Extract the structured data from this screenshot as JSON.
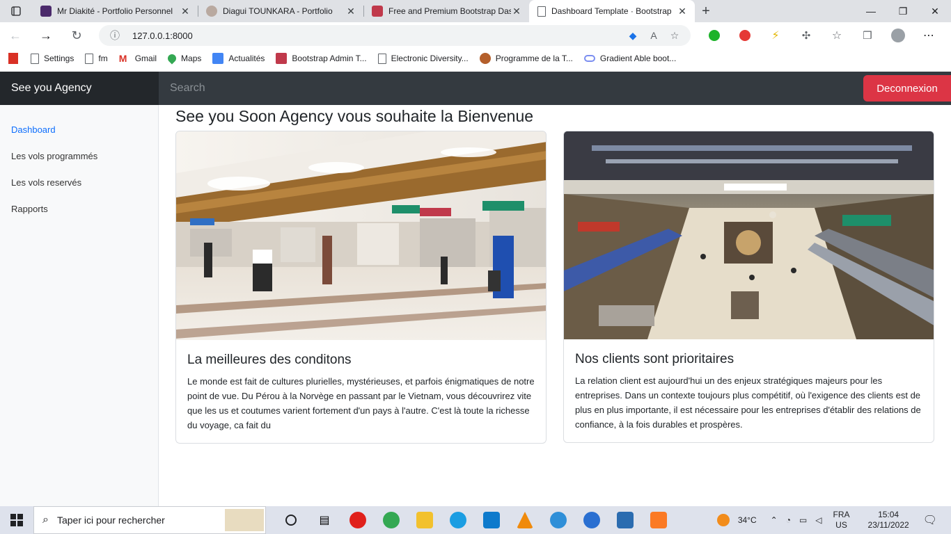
{
  "browser": {
    "tabs": [
      {
        "title": "Mr Diakité - Portfolio Personnel",
        "favicon_color": "#4b2a6b"
      },
      {
        "title": "Diagui TOUNKARA - Portfolio",
        "favicon_color": "#b9a9a0"
      },
      {
        "title": "Free and Premium Bootstrap Das",
        "favicon_color": "#c0394b"
      },
      {
        "title": "Dashboard Template · Bootstrap",
        "favicon_color": "#ffffff"
      }
    ],
    "url": "127.0.0.1:8000",
    "bookmarks": [
      {
        "label": "Settings",
        "icon": "page-icon"
      },
      {
        "label": "fm",
        "icon": "page-icon"
      },
      {
        "label": "Gmail",
        "icon": "gmail-icon"
      },
      {
        "label": "Maps",
        "icon": "maps-icon"
      },
      {
        "label": "Actualités",
        "icon": "news-icon"
      },
      {
        "label": "Bootstrap Admin T...",
        "icon": "bootstrap-icon"
      },
      {
        "label": "Electronic Diversity...",
        "icon": "page-icon"
      },
      {
        "label": "Programme de la T...",
        "icon": "globe-icon"
      },
      {
        "label": "Gradient Able boot...",
        "icon": "link-icon"
      }
    ]
  },
  "app": {
    "brand": "See you Agency",
    "search_placeholder": "Search",
    "logout_label": "Deconnexion",
    "sidebar": [
      {
        "label": "Dashboard",
        "active": true
      },
      {
        "label": "Les vols programmés",
        "active": false
      },
      {
        "label": "Les vols reservés",
        "active": false
      },
      {
        "label": "Rapports",
        "active": false
      }
    ],
    "page_title": "See you Soon Agency vous souhaite la Bienvenue",
    "cards": [
      {
        "title": "La meilleures des conditons",
        "text": "Le monde est fait de cultures plurielles, mystérieuses, et parfois énigmatiques de notre point de vue. Du Pérou à la Norvège en passant par le Vietnam, vous découvrirez vite que les us et coutumes varient fortement d'un pays à l'autre. C'est là toute la richesse du voyage, ca fait du"
      },
      {
        "title": "Nos clients sont prioritaires",
        "text": "La relation client est aujourd'hui un des enjeux stratégiques majeurs pour les entreprises. Dans un contexte toujours plus compétitif, où l'exigence des clients est de plus en plus importante, il est nécessaire pour les entreprises d'établir des relations de confiance, à la fois durables et prospères."
      }
    ]
  },
  "taskbar": {
    "search_placeholder": "Taper ici pour rechercher",
    "weather": "34°C",
    "lang_top": "FRA",
    "lang_bottom": "US",
    "time": "15:04",
    "date": "23/11/2022"
  }
}
